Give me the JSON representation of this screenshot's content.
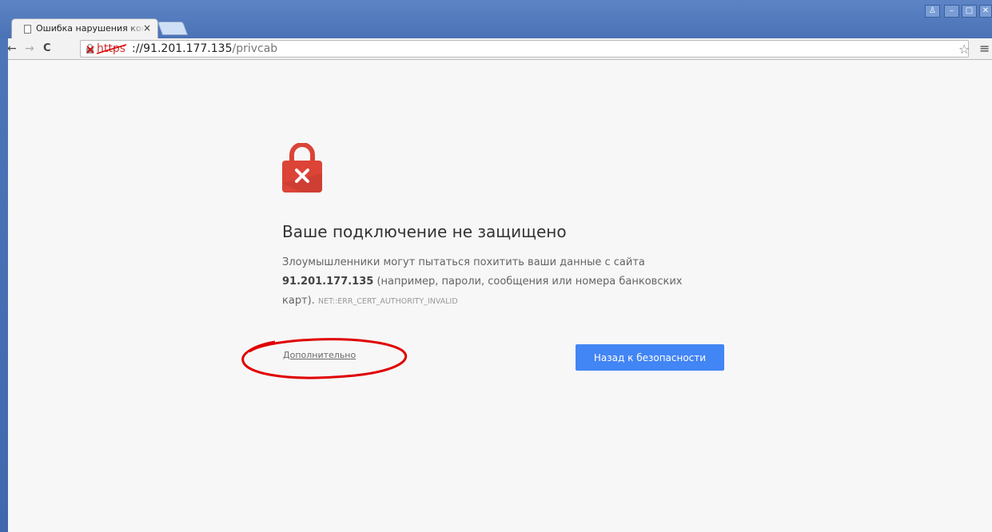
{
  "browser": {
    "tab": {
      "title": "Ошибка нарушения конфиденциальности",
      "close_glyph": "×"
    },
    "window_controls": {
      "user": "♙",
      "minimize": "–",
      "maximize": "□",
      "close": "✕"
    },
    "nav": {
      "back": "←",
      "forward": "→",
      "reload": "C"
    },
    "url": {
      "scheme": "https",
      "host_rest": "://91.201.177.135",
      "path": "/privcab"
    },
    "icons": {
      "star": "☆",
      "menu": "≡"
    }
  },
  "interstitial": {
    "heading": "Ваше подключение не защищено",
    "desc_part1": "Злоумышленники могут пытаться похитить ваши данные с сайта ",
    "host": "91.201.177.135",
    "desc_part2": " (например, пароли, сообщения или номера банковских карт).",
    "error_code": "NET::ERR_CERT_AUTHORITY_INVALID",
    "details_link": "Дополнительно",
    "back_button": "Назад к безопасности"
  },
  "colors": {
    "lock_red": "#db4437",
    "button_blue": "#4285f4",
    "annotation_red": "#e00000"
  }
}
